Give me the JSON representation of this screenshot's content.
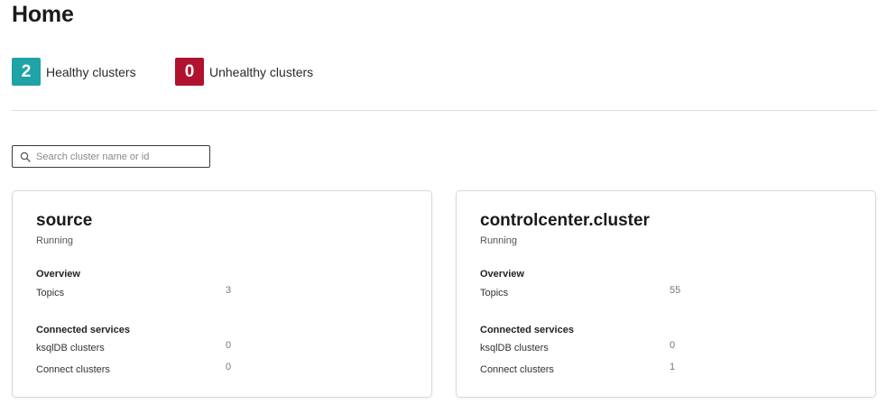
{
  "page": {
    "title": "Home"
  },
  "summary": {
    "healthy": {
      "count": "2",
      "label": "Healthy clusters",
      "color": "#1fa3a6"
    },
    "unhealthy": {
      "count": "0",
      "label": "Unhealthy clusters",
      "color": "#b0122f"
    }
  },
  "search": {
    "placeholder": "Search cluster name or id",
    "icon": "search-icon"
  },
  "clusters": [
    {
      "name": "source",
      "status": "Running",
      "overview_heading": "Overview",
      "topics_label": "Topics",
      "topics_value": "3",
      "services_heading": "Connected services",
      "ksqldb_label": "ksqlDB clusters",
      "ksqldb_value": "0",
      "connect_label": "Connect clusters",
      "connect_value": "0"
    },
    {
      "name": "controlcenter.cluster",
      "status": "Running",
      "overview_heading": "Overview",
      "topics_label": "Topics",
      "topics_value": "55",
      "services_heading": "Connected services",
      "ksqldb_label": "ksqlDB clusters",
      "ksqldb_value": "0",
      "connect_label": "Connect clusters",
      "connect_value": "1"
    }
  ]
}
